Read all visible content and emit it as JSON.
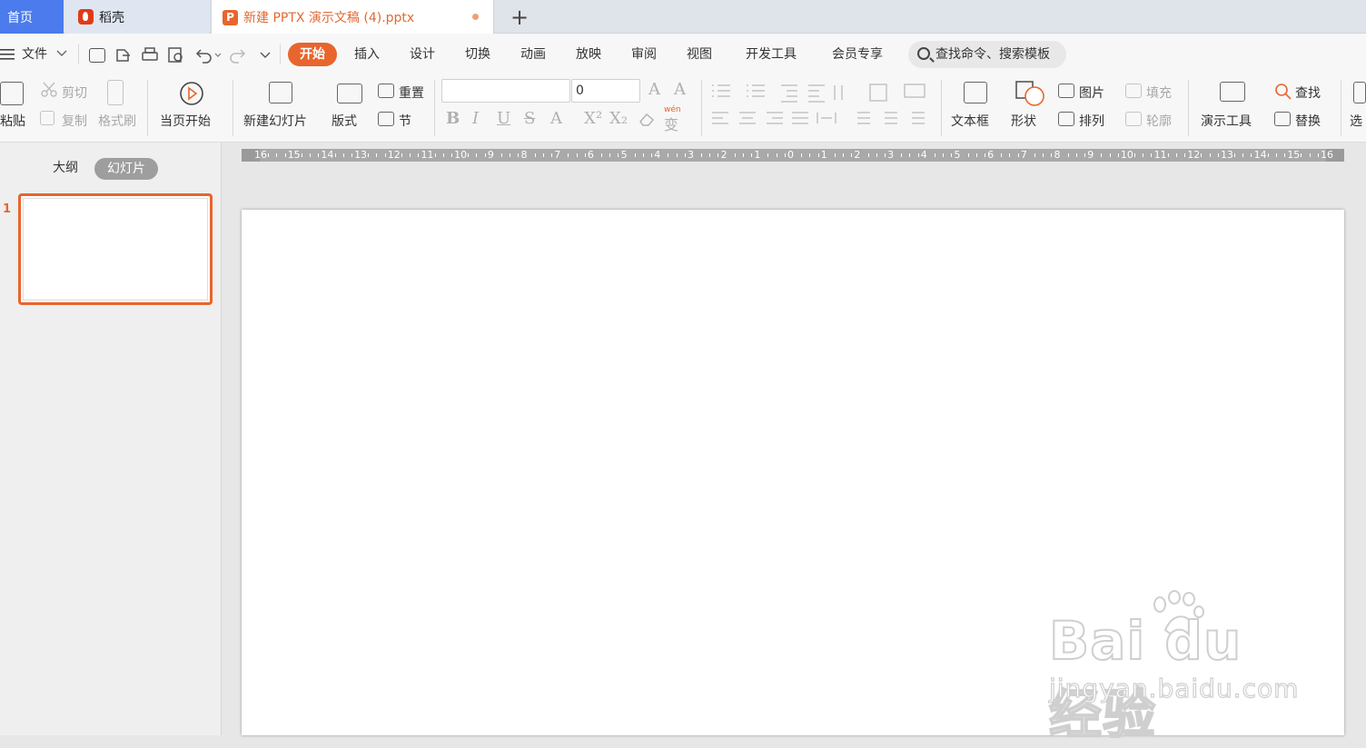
{
  "tabs": {
    "home": "首页",
    "daoke": "稻壳",
    "document": "新建 PPTX 演示文稿 (4).pptx",
    "new_tab": "+"
  },
  "menu": {
    "file": "文件",
    "items": [
      "开始",
      "插入",
      "设计",
      "切换",
      "动画",
      "放映",
      "审阅",
      "视图",
      "开发工具",
      "会员专享"
    ],
    "active": "开始",
    "search": "查找命令、搜索模板"
  },
  "ribbon": {
    "paste": "粘贴",
    "cut": "剪切",
    "copy": "复制",
    "format_painter": "格式刷",
    "play_from_current": "当页开始",
    "new_slide": "新建幻灯片",
    "layout": "版式",
    "reset": "重置",
    "section": "节",
    "font_name": "",
    "font_size": "0",
    "textbox": "文本框",
    "shape": "形状",
    "picture": "图片",
    "arrange": "排列",
    "fill": "填充",
    "outline": "轮廓",
    "presentation_tools": "演示工具",
    "find": "查找",
    "replace": "替换",
    "select": "选",
    "wen": "wén"
  },
  "left_panel": {
    "outline_tab": "大纲",
    "slides_tab": "幻灯片",
    "slide_number": "1"
  },
  "ruler": {
    "labels": [
      "16",
      "15",
      "14",
      "13",
      "12",
      "11",
      "10",
      "9",
      "8",
      "7",
      "6",
      "5",
      "4",
      "3",
      "2",
      "1",
      "0",
      "1",
      "2",
      "3",
      "4",
      "5",
      "6",
      "7",
      "8",
      "9",
      "10",
      "11",
      "12",
      "13",
      "14",
      "15",
      "16"
    ]
  },
  "watermark": {
    "logo": "Bai du 经验",
    "sub": "jingyan.baidu.com"
  },
  "colors": {
    "accent": "#e8652d",
    "home_tab": "#4b7bec"
  }
}
